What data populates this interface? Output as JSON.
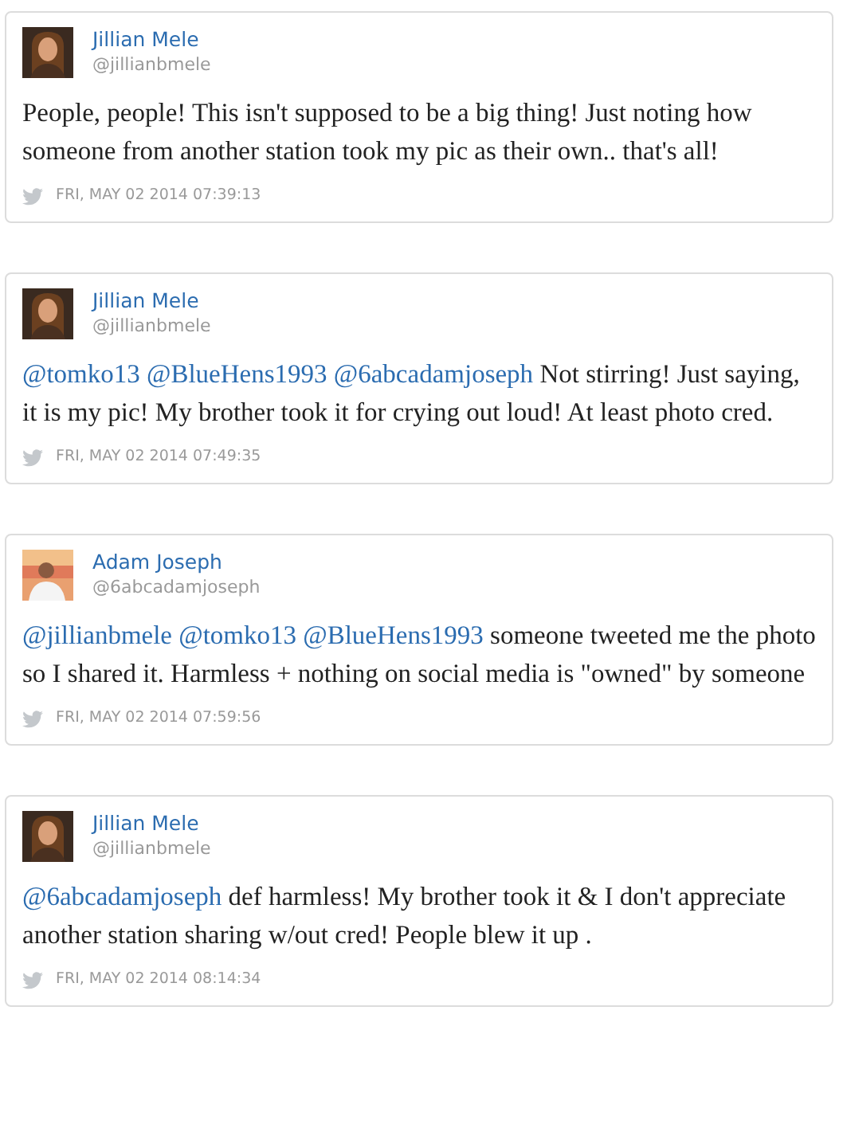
{
  "tweets": [
    {
      "name": "Jillian Mele",
      "handle": "@jillianbmele",
      "avatar": {
        "kind": "picture"
      },
      "text": [
        {
          "kind": "text",
          "text": "People, people! This isn't supposed to be a big thing! Just noting how someone from another station took my pic as their own.. that's all!"
        }
      ],
      "date": "FRI, MAY 02 2014 07:39:13"
    },
    {
      "name": "Jillian Mele",
      "handle": "@jillianbmele",
      "avatar": {
        "kind": "picture"
      },
      "text": [
        {
          "kind": "mention",
          "text": "@tomko13"
        },
        {
          "kind": "mention",
          "text": "@BlueHens1993"
        },
        {
          "kind": "mention",
          "text": "@6abcadamjoseph"
        },
        {
          "kind": "text",
          "text": " Not stirring! Just saying, it is my pic! My brother took it for crying out loud! At least photo cred."
        }
      ],
      "date": "FRI, MAY 02 2014 07:49:35"
    },
    {
      "name": "Adam Joseph",
      "handle": "@6abcadamjoseph",
      "avatar": {
        "kind": "picture"
      },
      "text": [
        {
          "kind": "mention",
          "text": "@jillianbmele"
        },
        {
          "kind": "mention",
          "text": "@tomko13"
        },
        {
          "kind": "mention",
          "text": "@BlueHens1993"
        },
        {
          "kind": "text",
          "text": " someone tweeted me the photo so I shared it. Harmless + nothing on social media is \"owned\" by someone"
        }
      ],
      "date": "FRI, MAY 02 2014 07:59:56"
    },
    {
      "name": "Jillian Mele",
      "handle": "@jillianbmele",
      "avatar": {
        "kind": "picture"
      },
      "text": [
        {
          "kind": "mention",
          "text": "@6abcadamjoseph"
        },
        {
          "kind": "text",
          "text": " def harmless! My brother took it & I don't appreciate another station sharing w/out cred! People blew it up ."
        }
      ],
      "date": "FRI, MAY 02 2014 08:14:34"
    }
  ]
}
